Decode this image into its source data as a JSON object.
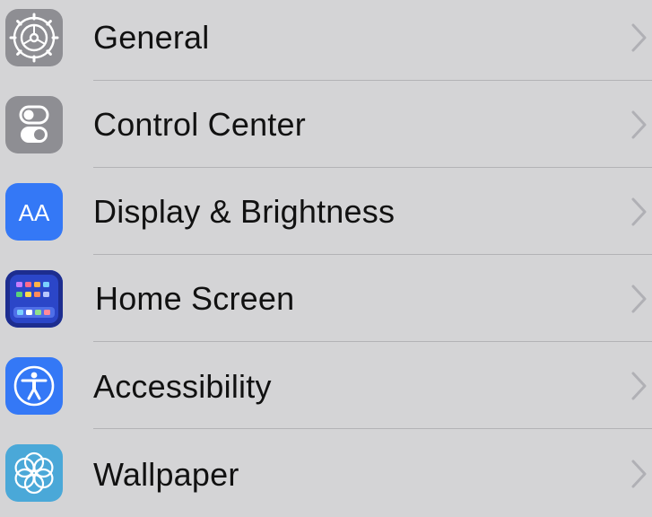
{
  "settings": {
    "items": [
      {
        "label": "General",
        "icon": "gear-icon",
        "icon_bg": "#8e8e93"
      },
      {
        "label": "Control Center",
        "icon": "switches-icon",
        "icon_bg": "#8e8e93"
      },
      {
        "label": "Display & Brightness",
        "icon": "text-size-icon",
        "icon_bg": "#3478f6"
      },
      {
        "label": "Home Screen",
        "icon": "app-grid-icon",
        "icon_bg": "#2f5be0"
      },
      {
        "label": "Accessibility",
        "icon": "accessibility-icon",
        "icon_bg": "#3478f6"
      },
      {
        "label": "Wallpaper",
        "icon": "flower-icon",
        "icon_bg": "#4aa8d8"
      }
    ],
    "display_icon_text": "AA",
    "chevron_color": "#b0b0b5"
  }
}
